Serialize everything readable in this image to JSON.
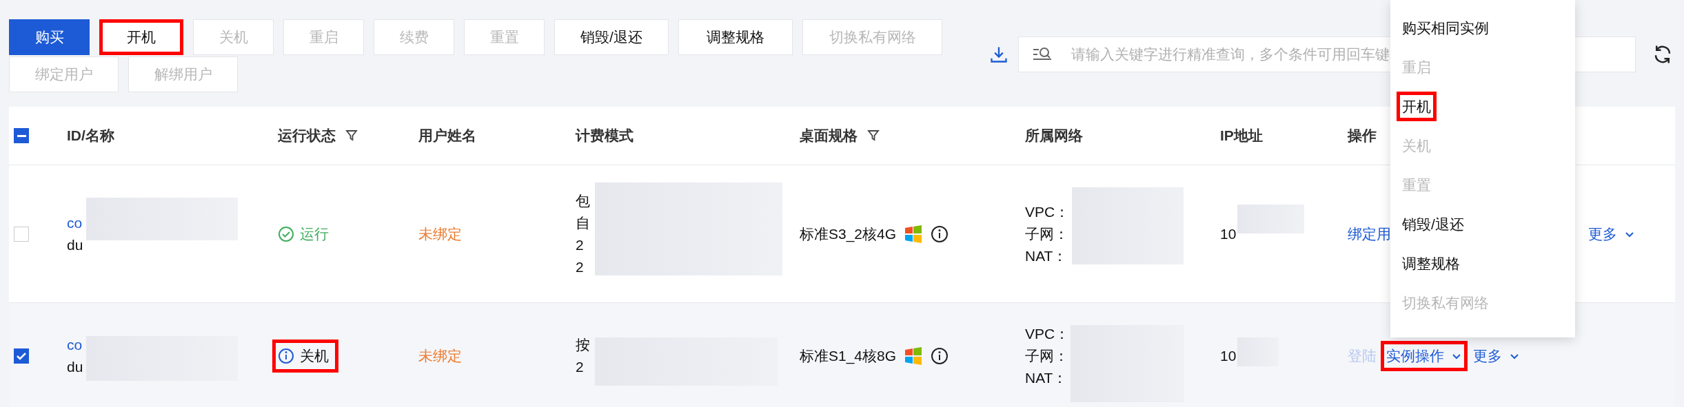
{
  "toolbar": {
    "buttons": [
      {
        "label": "购买",
        "kind": "primary",
        "highlighted": false
      },
      {
        "label": "开机",
        "kind": "normal",
        "highlighted": true
      },
      {
        "label": "关机",
        "kind": "disabled",
        "highlighted": false
      },
      {
        "label": "重启",
        "kind": "disabled",
        "highlighted": false
      },
      {
        "label": "续费",
        "kind": "disabled",
        "highlighted": false
      },
      {
        "label": "重置",
        "kind": "disabled",
        "highlighted": false
      },
      {
        "label": "销毁/退还",
        "kind": "normal",
        "highlighted": false
      },
      {
        "label": "调整规格",
        "kind": "normal",
        "highlighted": false
      },
      {
        "label": "切换私有网络",
        "kind": "disabled",
        "highlighted": false
      },
      {
        "label": "绑定用户",
        "kind": "disabled",
        "highlighted": false
      },
      {
        "label": "解绑用户",
        "kind": "disabled",
        "highlighted": false
      }
    ],
    "search": {
      "placeholder": "请输入关键字进行精准查询，多个条件可用回车键"
    }
  },
  "table": {
    "select_all": {
      "indeterminate": true
    },
    "columns": [
      {
        "label": "ID/名称",
        "filter": false
      },
      {
        "label": "运行状态",
        "filter": true
      },
      {
        "label": "用户姓名",
        "filter": false
      },
      {
        "label": "计费模式",
        "filter": false
      },
      {
        "label": "桌面规格",
        "filter": true
      },
      {
        "label": "所属网络",
        "filter": false
      },
      {
        "label": "IP地址",
        "filter": false
      },
      {
        "label": "操作",
        "filter": false
      }
    ],
    "rows": [
      {
        "checked": false,
        "id": "co",
        "name": "du",
        "status": {
          "kind": "running",
          "label": "运行",
          "highlighted": false
        },
        "user": "未绑定",
        "billing": [
          "包",
          "自",
          "2",
          "2"
        ],
        "spec": "标准S3_2核4G",
        "network": [
          "VPC：",
          "子网：",
          "NAT："
        ],
        "ip": "10",
        "actions": [
          {
            "label": "绑定用",
            "kind": "link",
            "highlighted": false
          },
          {
            "label": "更多",
            "kind": "more",
            "highlighted": false
          }
        ]
      },
      {
        "checked": true,
        "id": "co",
        "name": "du",
        "status": {
          "kind": "stopped",
          "label": "关机",
          "highlighted": true
        },
        "user": "未绑定",
        "billing": [
          "按",
          "2"
        ],
        "spec": "标准S1_4核8G",
        "network": [
          "VPC：",
          "子网：",
          "NAT："
        ],
        "ip": "10",
        "actions": [
          {
            "label": "登陆",
            "kind": "disabled",
            "highlighted": false
          },
          {
            "label": "实例操作",
            "kind": "dropdown",
            "highlighted": true
          },
          {
            "label": "更多",
            "kind": "more",
            "highlighted": false
          }
        ]
      }
    ]
  },
  "menu": {
    "items": [
      {
        "label": "购买相同实例",
        "disabled": false,
        "highlighted": false
      },
      {
        "label": "重启",
        "disabled": true,
        "highlighted": false
      },
      {
        "label": "开机",
        "disabled": false,
        "highlighted": true
      },
      {
        "label": "关机",
        "disabled": true,
        "highlighted": false
      },
      {
        "label": "重置",
        "disabled": true,
        "highlighted": false
      },
      {
        "label": "销毁/退还",
        "disabled": false,
        "highlighted": false
      },
      {
        "label": "调整规格",
        "disabled": false,
        "highlighted": false
      },
      {
        "label": "切换私有网络",
        "disabled": true,
        "highlighted": false
      }
    ]
  }
}
